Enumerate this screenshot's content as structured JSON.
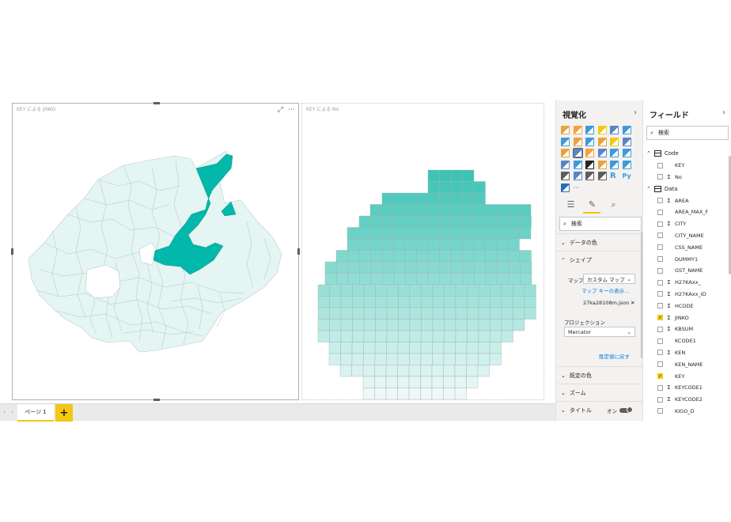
{
  "canvas": {
    "visual1": {
      "title": "KEY による JINKO",
      "icons": {
        "focus": "⤢",
        "more": "⋯"
      },
      "fill_color": "#01b8aa",
      "light_color": "#dff3f1"
    },
    "visual2": {
      "title": "KEY による No",
      "top_color": "#3ec4b6",
      "bottom_color": "#eef9f7"
    }
  },
  "pagebar": {
    "page_label": "ページ 1",
    "add_label": "+",
    "prev": "‹",
    "next": "›"
  },
  "viz_pane": {
    "title": "視覚化",
    "chevron": "›",
    "search_placeholder": "検索",
    "sections": {
      "data_colors": "データの色",
      "shape": "シェイプ",
      "default_color": "既定の色",
      "zoom": "ズーム",
      "title": "タイトル"
    },
    "map_label": "マップ",
    "map_value": "カスタム マップ",
    "map_keys_link": "マップ キーの表示...",
    "map_file": "27ka28108m.json",
    "projection_label": "プロジェクション",
    "projection_value": "Mercator",
    "reset_link": "既定値に戻す",
    "title_toggle_label": "オン",
    "icon_colors": [
      "#e8a33d",
      "#f2a33a",
      "#3e9ad8",
      "#f2c811",
      "#5b84c4",
      "#3e9ad8",
      "#3e9ad8",
      "#e8a33d",
      "#3e9ad8",
      "#e8a33d",
      "#f2c811",
      "#5b84c4",
      "#e8a33d",
      "#5b84c4",
      "#f2a33a",
      "#5b84c4",
      "#3e9ad8",
      "#3e9ad8",
      "#5b84c4",
      "#3e9ad8",
      "#252423",
      "#e8a33d",
      "#3e9ad8",
      "#3e9ad8",
      "#605e5c",
      "#5b84c4",
      "#605e5c",
      "#605e5c",
      "#3e9ad8",
      "#3e9ad8",
      "#2b6bb5"
    ],
    "icon_glyph_r": "R",
    "icon_glyph_py": "Py",
    "icon_more": "···"
  },
  "fields_pane": {
    "title": "フィールド",
    "chevron": "›",
    "search_placeholder": "検索",
    "tables": [
      {
        "name": "Code",
        "fields": [
          {
            "name": "KEY",
            "sigma": false,
            "checked": false
          },
          {
            "name": "No",
            "sigma": true,
            "checked": false
          }
        ]
      },
      {
        "name": "Data",
        "fields": [
          {
            "name": "AREA",
            "sigma": true,
            "checked": false
          },
          {
            "name": "AREA_MAX_F",
            "sigma": false,
            "checked": false
          },
          {
            "name": "CITY",
            "sigma": true,
            "checked": false
          },
          {
            "name": "CITY_NAME",
            "sigma": false,
            "checked": false
          },
          {
            "name": "CSS_NAME",
            "sigma": false,
            "checked": false
          },
          {
            "name": "DUMMY1",
            "sigma": false,
            "checked": false
          },
          {
            "name": "GST_NAME",
            "sigma": false,
            "checked": false
          },
          {
            "name": "H27KAxx_",
            "sigma": true,
            "checked": false
          },
          {
            "name": "H27KAxx_ID",
            "sigma": true,
            "checked": false
          },
          {
            "name": "HCODE",
            "sigma": true,
            "checked": false
          },
          {
            "name": "JINKO",
            "sigma": true,
            "checked": true
          },
          {
            "name": "KBSUM",
            "sigma": true,
            "checked": false
          },
          {
            "name": "KCODE1",
            "sigma": false,
            "checked": false
          },
          {
            "name": "KEN",
            "sigma": true,
            "checked": false
          },
          {
            "name": "KEN_NAME",
            "sigma": false,
            "checked": false
          },
          {
            "name": "KEY",
            "sigma": false,
            "checked": true
          },
          {
            "name": "KEYCODE1",
            "sigma": true,
            "checked": false
          },
          {
            "name": "KEYCODE2",
            "sigma": true,
            "checked": false
          },
          {
            "name": "KIGO_D",
            "sigma": false,
            "checked": false
          }
        ]
      }
    ]
  }
}
